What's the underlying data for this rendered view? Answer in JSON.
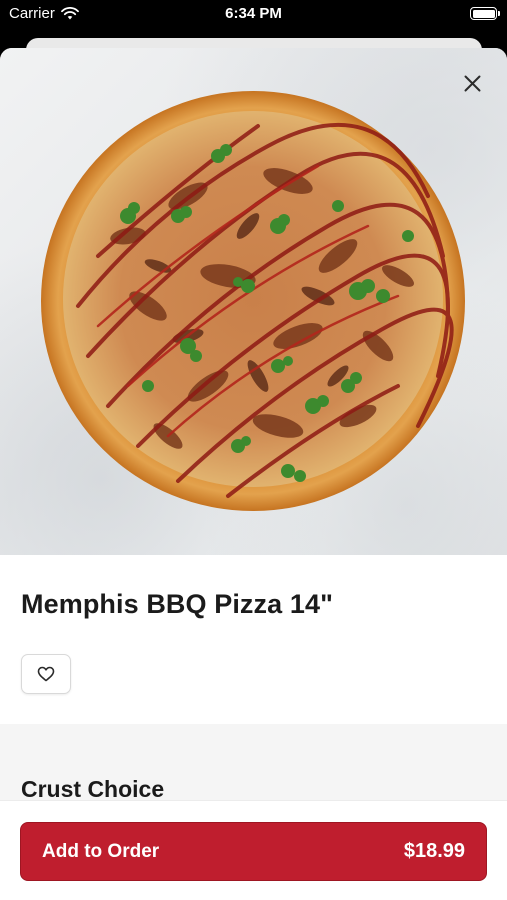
{
  "status_bar": {
    "carrier": "Carrier",
    "time": "6:34 PM"
  },
  "item": {
    "name": "Memphis BBQ Pizza 14\"",
    "image_alt": "pizza-photo"
  },
  "sections": {
    "crust_title": "Crust Choice"
  },
  "order": {
    "button_label": "Add to Order",
    "price": "$18.99"
  },
  "colors": {
    "accent": "#bf1e2e"
  },
  "icons": {
    "close": "close-icon",
    "favorite": "heart-icon",
    "wifi": "wifi-icon",
    "battery": "battery-icon"
  }
}
